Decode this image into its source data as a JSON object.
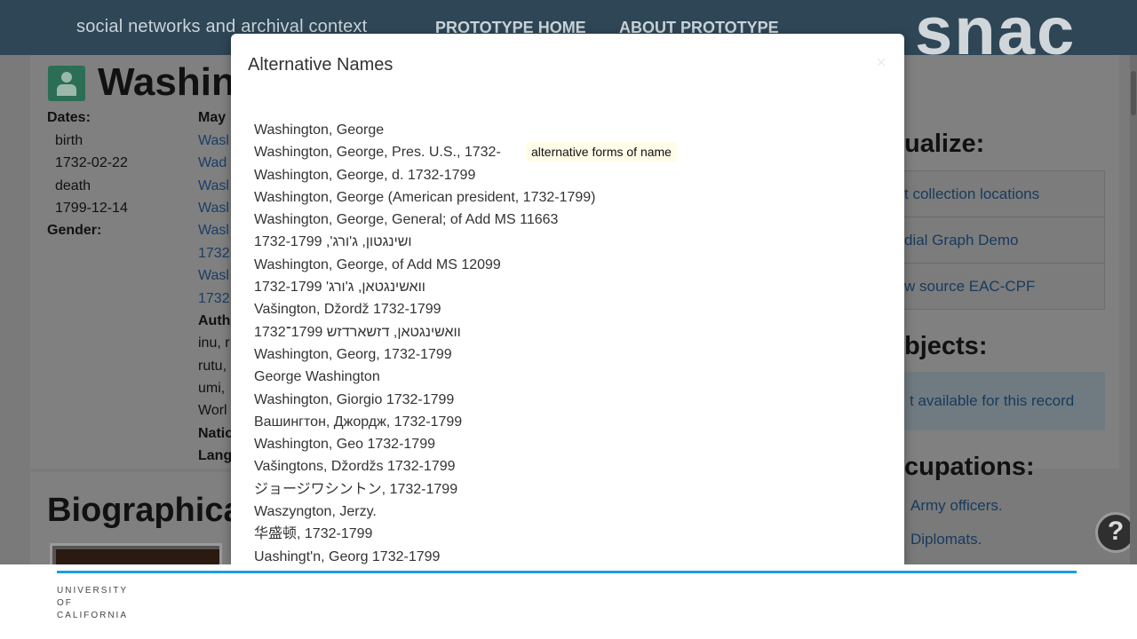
{
  "header": {
    "site_title": "social networks and archival context",
    "nav": [
      "PROTOTYPE HOME",
      "ABOUT PROTOTYPE"
    ],
    "logo": "snac"
  },
  "record": {
    "name_fragment": "Washin",
    "dates_label": "Dates:",
    "dates": [
      "birth",
      "1732-02-22",
      "death",
      "1799-12-14"
    ],
    "gender_label": "Gender:",
    "may_label": "May",
    "link_fragments": [
      "Wasl",
      "Wad",
      "Wasl",
      "Wasl",
      "Wasl",
      "1732",
      "Wasl",
      "1732"
    ],
    "bold_fragments": [
      "Auth",
      "Natio",
      "Lang"
    ],
    "text_fragments": [
      "inu, r",
      "rutu,",
      "umi,",
      "Worl"
    ],
    "bio_heading": "Biographica"
  },
  "right_panel": {
    "visualize_heading": "ualize:",
    "visualize_items": [
      "t collection locations",
      "dial Graph Demo",
      "w source EAC-CPF"
    ],
    "objects_heading": "bjects:",
    "objects_text": "t available for this record",
    "occupations_heading": "cupations:",
    "occupations": [
      "Army officers.",
      "Diplomats."
    ]
  },
  "help_button": "?",
  "modal": {
    "title": "Alternative Names",
    "close": "×",
    "names": [
      "Washington, George",
      "Washington, George, Pres. U.S., 1732-",
      "Washington, George, d. 1732-1799",
      "Washington, George (American president, 1732-1799)",
      "Washington, George, General; of Add MS 11663",
      "ושינגטון, ג'ורג', 1732-1799",
      "Washington, George, of Add MS 12099",
      "וואשינגטאן, ג'ורג' 1732-1799",
      "Vašington, Džordž 1732-1799",
      "וואשינגטאן, דזשארדזש 1799־1732",
      "Washington, Georg, 1732-1799",
      "George Washington",
      "Washington, Giorgio 1732-1799",
      "Вашингтон, Джордж, 1732-1799",
      "Washington, Geo 1732-1799",
      "Vašingtons, Džordžs 1732-1799",
      "ジョージワシントン, 1732-1799",
      "Waszyngton, Jerzy.",
      "华盛顿, 1732-1799",
      "Uashingt'n, Georg 1732-1799"
    ],
    "tooltip": "alternative forms of name"
  },
  "footer": {
    "org_lines": [
      "UNIVERSITY",
      "OF",
      "CALIFORNIA"
    ],
    "rule_color": "#1aa0d8"
  }
}
